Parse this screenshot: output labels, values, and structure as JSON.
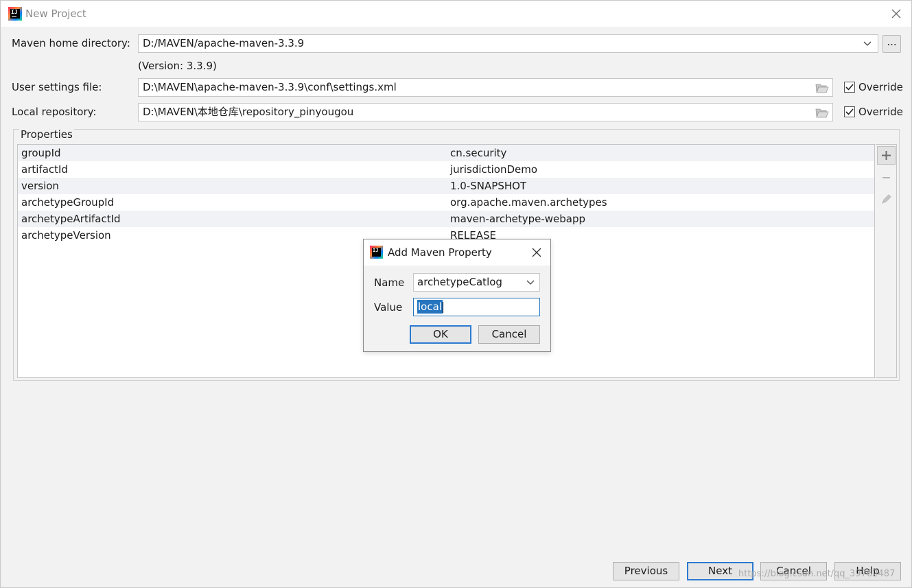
{
  "window": {
    "title": "New Project",
    "close_icon": "close-icon"
  },
  "maven_home": {
    "label": "Maven home directory:",
    "value": "D:/MAVEN/apache-maven-3.3.9",
    "browse_label": "...",
    "version": "(Version: 3.3.9)"
  },
  "user_settings": {
    "label": "User settings file:",
    "value": "D:\\MAVEN\\apache-maven-3.3.9\\conf\\settings.xml",
    "override_label": "Override",
    "override_checked": true
  },
  "local_repo": {
    "label": "Local repository:",
    "value": "D:\\MAVEN\\本地仓库\\repository_pinyougou",
    "override_label": "Override",
    "override_checked": true
  },
  "properties": {
    "title": "Properties",
    "rows": [
      {
        "key": "groupId",
        "value": "cn.security"
      },
      {
        "key": "artifactId",
        "value": "jurisdictionDemo"
      },
      {
        "key": "version",
        "value": "1.0-SNAPSHOT"
      },
      {
        "key": "archetypeGroupId",
        "value": "org.apache.maven.archetypes"
      },
      {
        "key": "archetypeArtifactId",
        "value": "maven-archetype-webapp"
      },
      {
        "key": "archetypeVersion",
        "value": "RELEASE"
      }
    ],
    "tools": [
      "add-icon",
      "remove-icon",
      "edit-icon"
    ]
  },
  "dialog": {
    "title": "Add Maven Property",
    "name_label": "Name",
    "name_value": "archetypeCatlog",
    "value_label": "Value",
    "value_value": "local",
    "ok_label": "OK",
    "cancel_label": "Cancel"
  },
  "footer": {
    "previous_label": "Previous",
    "next_label": "Next",
    "cancel_label": "Cancel",
    "help_label": "Help"
  },
  "watermark": "https://blog.csdn.net/qq_39762487",
  "colors": {
    "accent": "#2b79d0",
    "selection": "#2675bf",
    "background": "#f2f2f2"
  }
}
